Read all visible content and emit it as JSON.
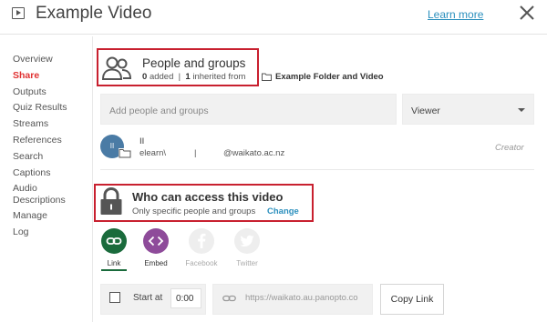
{
  "header": {
    "title": "Example Video",
    "learn_more": "Learn more"
  },
  "sidebar": {
    "items": [
      {
        "label": "Overview"
      },
      {
        "label": "Share"
      },
      {
        "label": "Outputs"
      },
      {
        "label": "Quiz Results"
      },
      {
        "label": "Streams"
      },
      {
        "label": "References"
      },
      {
        "label": "Search"
      },
      {
        "label": "Captions"
      },
      {
        "label": "Audio Descriptions"
      },
      {
        "label": "Manage"
      },
      {
        "label": "Log"
      }
    ],
    "active": "Share"
  },
  "people_groups": {
    "title": "People and groups",
    "added_count": "0",
    "added_label": "added",
    "separator": "|",
    "inherited_count": "1",
    "inherited_label": "inherited from",
    "folder_name": "Example Folder and Video"
  },
  "add_people": {
    "placeholder": "Add people and groups",
    "role_selected": "Viewer"
  },
  "user": {
    "initials": "II",
    "name": "II",
    "email_part1": "elearn\\",
    "separator": "|",
    "email_part2": "@waikato.ac.nz",
    "role": "Creator"
  },
  "access": {
    "title": "Who can access this video",
    "subtitle": "Only specific people and groups",
    "change": "Change"
  },
  "share_buttons": [
    {
      "label": "Link",
      "color": "#1a6b3c",
      "active": true
    },
    {
      "label": "Embed",
      "color": "#8e4b9a",
      "active": false
    },
    {
      "label": "Facebook",
      "color": "#eeeeee",
      "active": false
    },
    {
      "label": "Twitter",
      "color": "#eeeeee",
      "active": false
    }
  ],
  "link_options": {
    "start_at_label": "Start at",
    "start_time": "0:00",
    "url": "https://waikato.au.panopto.co",
    "copy_label": "Copy Link"
  },
  "colors": {
    "accent": "#e03131",
    "link_blue": "#2a8fbd",
    "highlight_box": "#c8202f"
  }
}
